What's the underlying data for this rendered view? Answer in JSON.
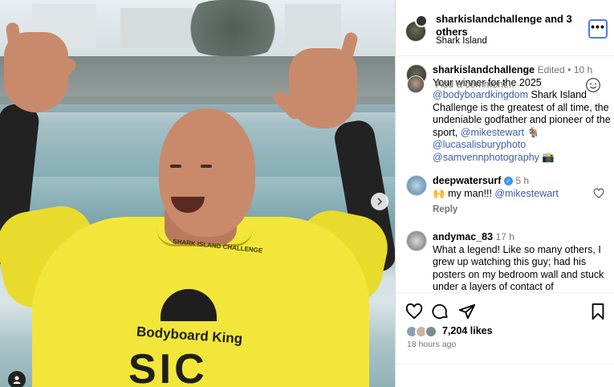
{
  "post": {
    "header": {
      "title": "sharkislandchallenge and 3 others",
      "location": "Shark Island",
      "more_label": "•••"
    },
    "image": {
      "alt_subject": "photo",
      "shirt_collar_text": "SHARK ISLAND CHALLENGE",
      "shirt_print": "Bodyboard King",
      "shirt_big": "SIC"
    },
    "caption": {
      "username": "sharkislandchallenge",
      "edited": "Edited",
      "time": "10 h",
      "text_1": "Your winner for the 2025",
      "mention_1": "@bodyboardkingdom",
      "text_2": "Shark Island Challenge is the greatest of all time, the undeniable godfather and pioneer of the sport,",
      "mention_2": "@mikestewart",
      "emoji_2": "🐐",
      "mention_3": "@lucasalisburyphoto",
      "mention_4": "@samvennphotography",
      "emoji_4": "📸"
    },
    "comments": [
      {
        "username": "deepwatersurf",
        "time": "5 h",
        "emoji": "🙌",
        "text": "my man!!!",
        "mention": "@mikestewart",
        "reply_label": "Reply"
      },
      {
        "username": "andymac_83",
        "time": "17 h",
        "text": "What a legend! Like so many others, I grew up watching this guy; had his posters on my bedroom wall and stuck under a layers of contact of"
      }
    ],
    "likes": "7,204 likes",
    "posted_ago": "18 hours ago",
    "add_comment_placeholder": "Add a comment..."
  },
  "icons": [
    "heart-icon",
    "comment-icon",
    "share-icon",
    "bookmark-icon",
    "emoji-icon",
    "chevron-right-icon",
    "user-tag-icon",
    "verified-icon"
  ],
  "colors": {
    "link": "#3c5ea8",
    "meta": "#737373",
    "verified": "#3897f0",
    "focus": "#4a7be0"
  }
}
